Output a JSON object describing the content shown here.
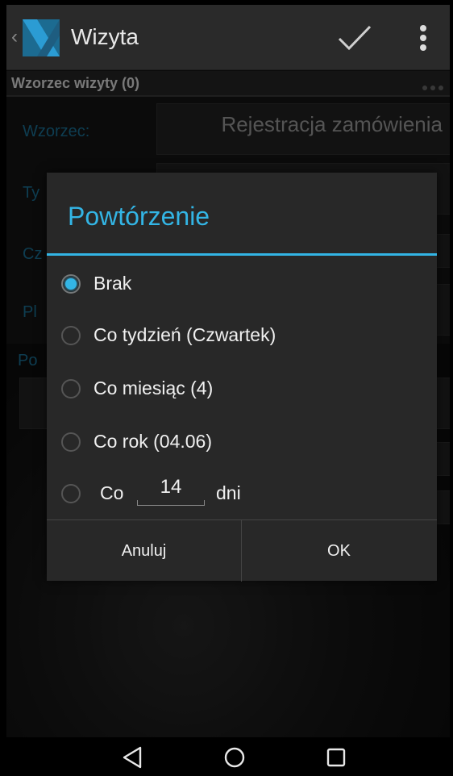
{
  "actionbar": {
    "title": "Wizyta"
  },
  "section": {
    "title": "Wzorzec wizyty (0)"
  },
  "form": {
    "wzorzec_label": "Wzorzec:",
    "wzorzec_value": "Rejestracja zamówienia",
    "partial_labels": [
      "Ty",
      "Cz",
      "Pl",
      "Po"
    ]
  },
  "dialog": {
    "title": "Powtórzenie",
    "options": [
      {
        "label": "Brak",
        "checked": true
      },
      {
        "label": "Co tydzień (Czwartek)",
        "checked": false
      },
      {
        "label": "Co miesiąc (4)",
        "checked": false
      },
      {
        "label": "Co rok (04.06)",
        "checked": false
      }
    ],
    "custom": {
      "prefix": "Co",
      "days": "14",
      "suffix": "dni"
    },
    "cancel_label": "Anuluj",
    "ok_label": "OK"
  },
  "colors": {
    "accent": "#33b5e5",
    "label_blue": "#1a6f94"
  },
  "icons": [
    "back-chevron-icon",
    "app-logo-icon",
    "check-icon",
    "overflow-menu-icon",
    "nav-back-icon",
    "nav-home-icon",
    "nav-recents-icon"
  ]
}
